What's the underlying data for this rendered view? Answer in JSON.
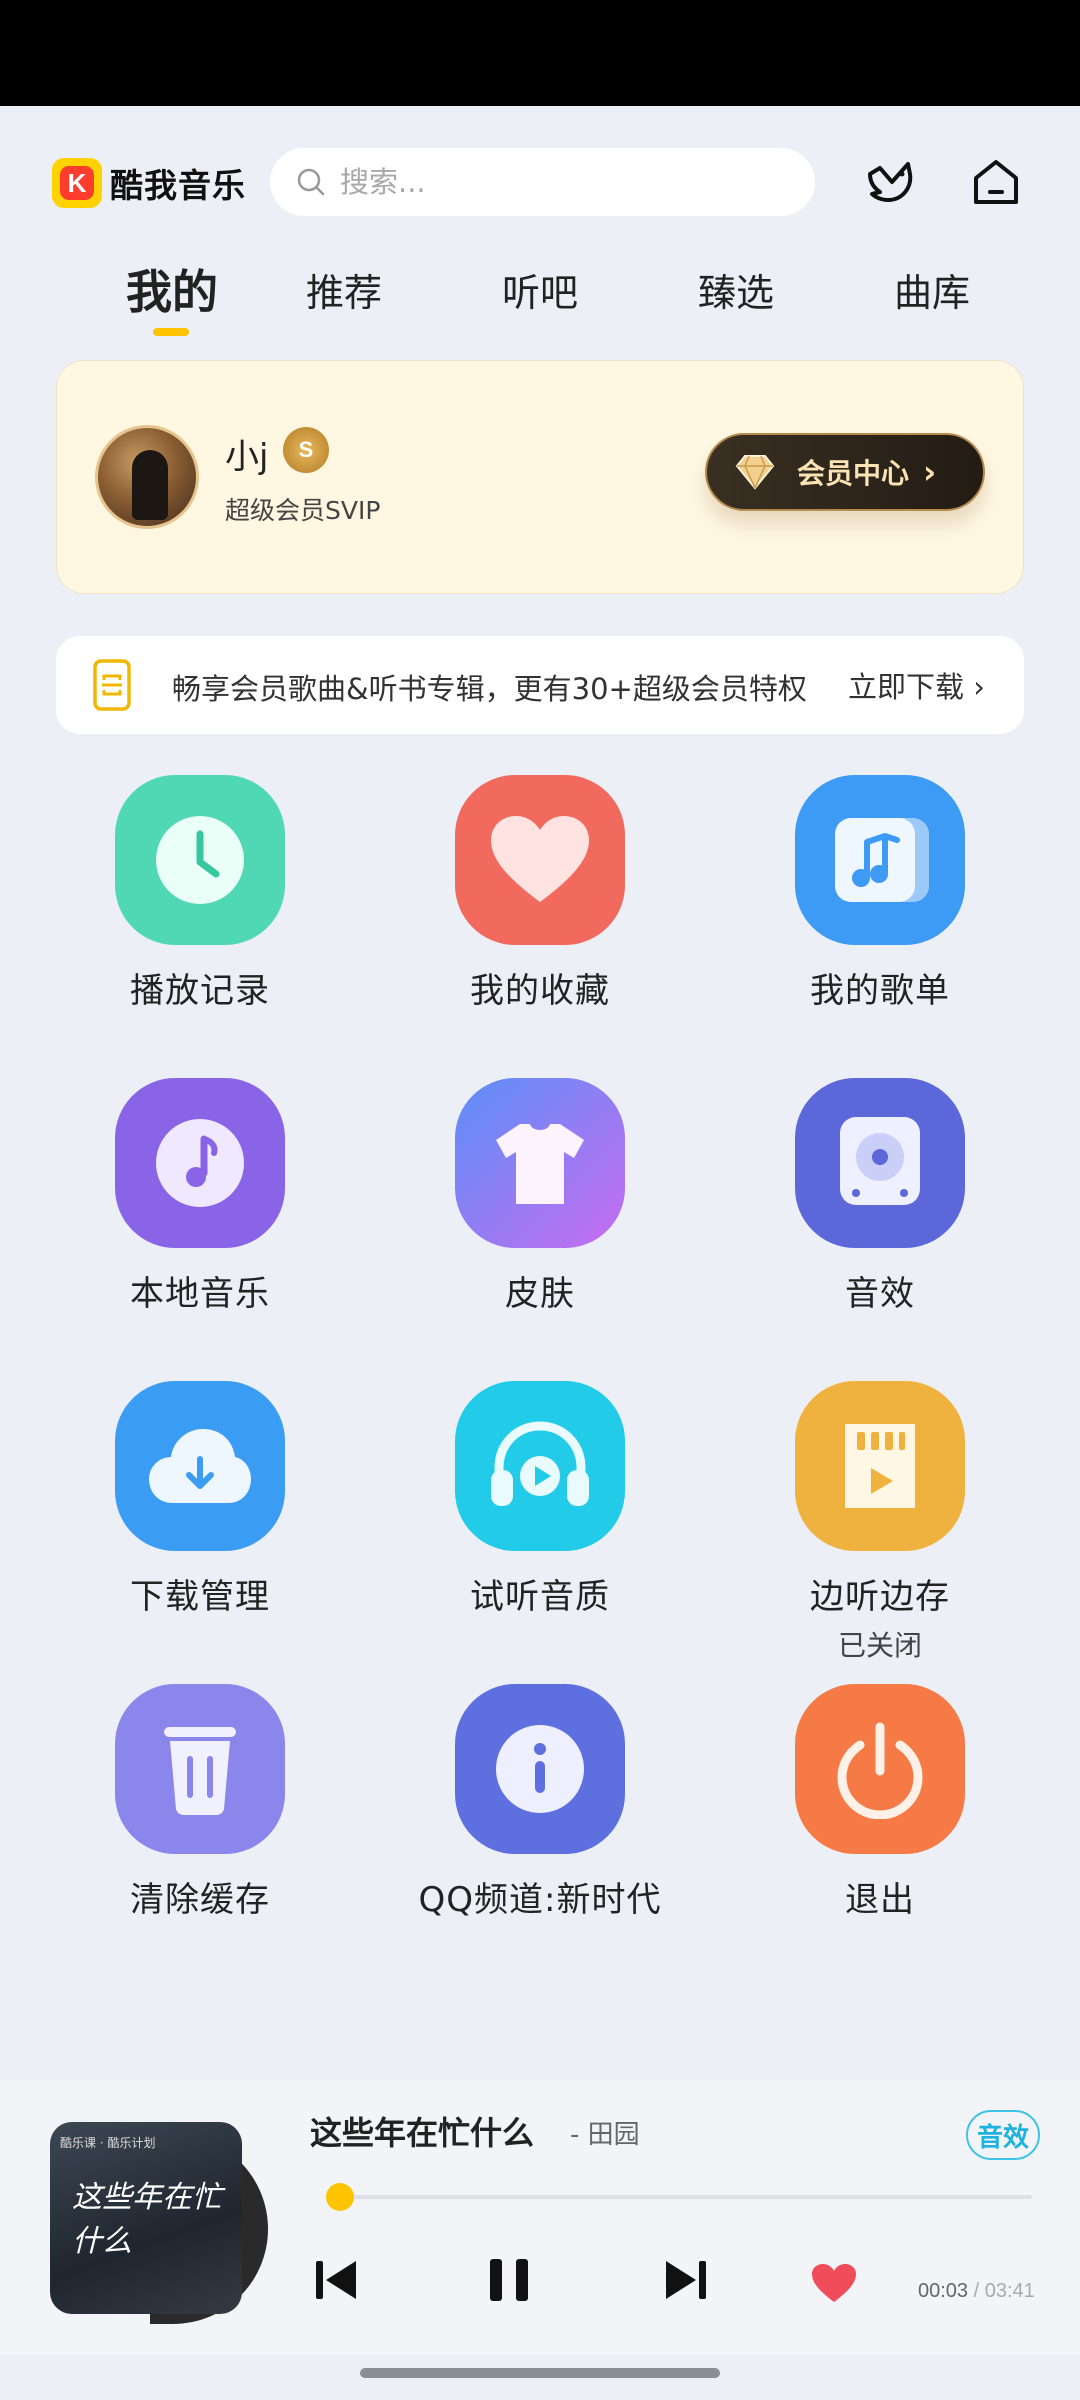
{
  "app": {
    "name": "酷我音乐",
    "logo_letter": "K"
  },
  "search": {
    "placeholder": "搜索..."
  },
  "tabs": [
    {
      "label": "我的",
      "active": true
    },
    {
      "label": "推荐",
      "active": false
    },
    {
      "label": "听吧",
      "active": false
    },
    {
      "label": "臻选",
      "active": false
    },
    {
      "label": "曲库",
      "active": false
    }
  ],
  "member": {
    "name": "小j",
    "badge": "S",
    "level": "超级会员SVIP",
    "center_label": "会员中心",
    "chevron": "›"
  },
  "promo": {
    "text": "畅享会员歌曲&听书专辑，更有30+超级会员特权",
    "action": "立即下载 ›"
  },
  "grid": [
    {
      "label": "播放记录",
      "icon": "clock-icon",
      "color": "#4fd8b3"
    },
    {
      "label": "我的收藏",
      "icon": "heart-icon",
      "color": "#f26a5e"
    },
    {
      "label": "我的歌单",
      "icon": "music-note-icon",
      "color": "#3d9af5"
    },
    {
      "label": "本地音乐",
      "icon": "local-music-icon",
      "color": "#8a64e6"
    },
    {
      "label": "皮肤",
      "icon": "tshirt-icon",
      "color": "#7a83f2"
    },
    {
      "label": "音效",
      "icon": "speaker-icon",
      "color": "#5c67d9"
    },
    {
      "label": "下载管理",
      "icon": "cloud-download-icon",
      "color": "#3b9cf4"
    },
    {
      "label": "试听音质",
      "icon": "headphones-icon",
      "color": "#22cbe8"
    },
    {
      "label": "边听边存",
      "sub": "已关闭",
      "icon": "sd-card-icon",
      "color": "#f0b23f"
    },
    {
      "label": "清除缓存",
      "icon": "trash-icon",
      "color": "#8a86ec"
    },
    {
      "label": "QQ频道:新时代",
      "icon": "info-icon",
      "color": "#5e6fdf"
    },
    {
      "label": "退出",
      "icon": "power-icon",
      "color": "#f67a45"
    }
  ],
  "player": {
    "title": "这些年在忙什么",
    "artist": "- 田园",
    "fx_label": "音效",
    "current_time": "00:03",
    "separator": "/",
    "total_time": "03:41",
    "progress": 0.014,
    "cover_caption": "酷乐课 · 酷乐计划",
    "cover_title": "这些年在忙什么"
  }
}
